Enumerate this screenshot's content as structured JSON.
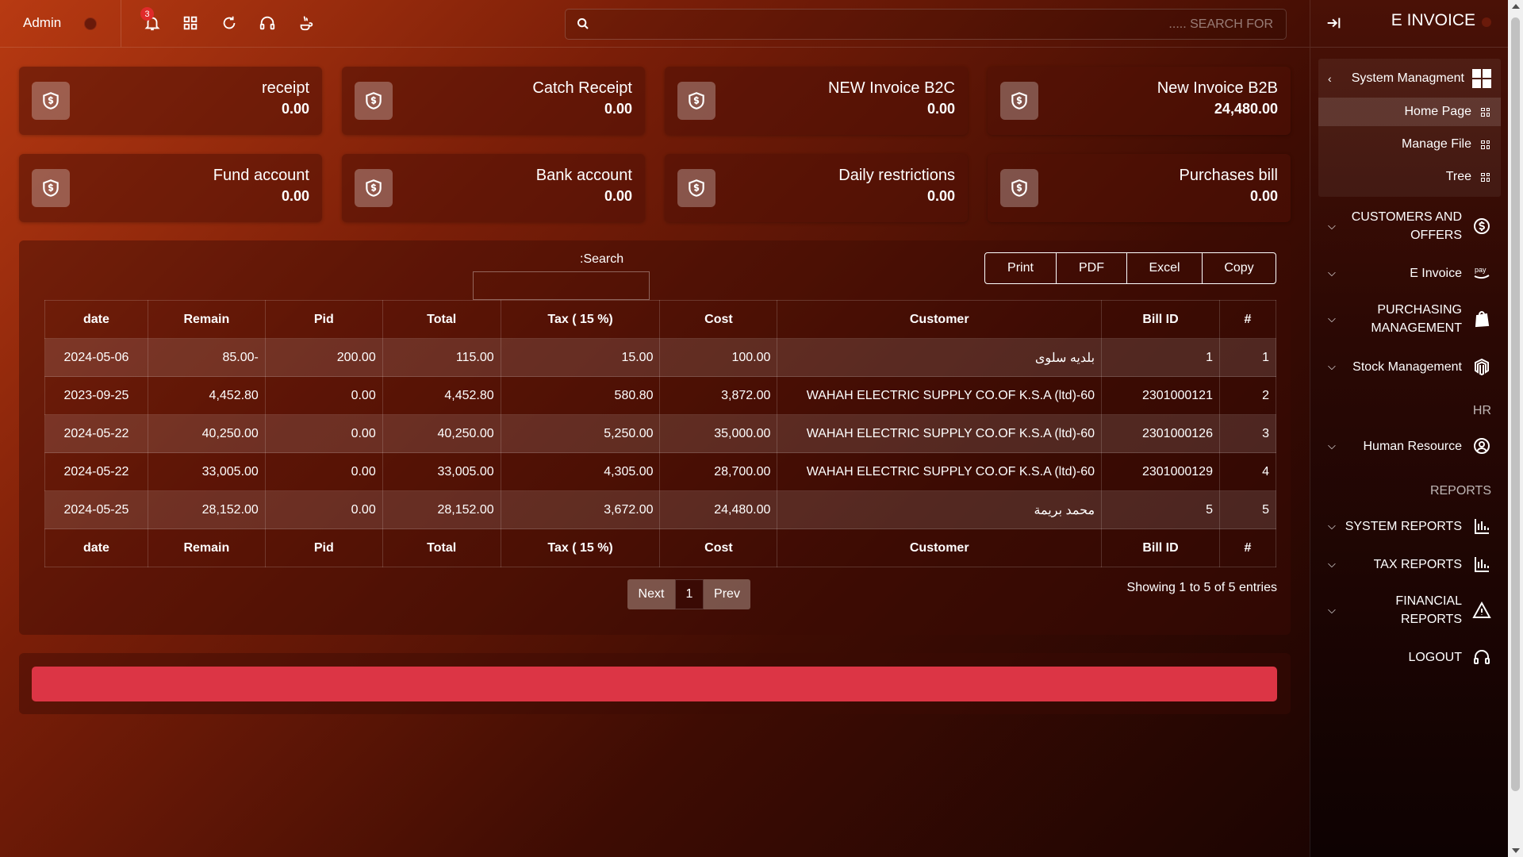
{
  "topbar": {
    "user": "Admin",
    "notification_count": "3",
    "search_placeholder": "..... SEARCH FOR"
  },
  "sidebar": {
    "title": "E INVOICE",
    "system_management": {
      "label": "System Managment",
      "items": [
        {
          "label": "Home Page",
          "active": true
        },
        {
          "label": "Manage File",
          "active": false
        },
        {
          "label": "Tree",
          "active": false
        }
      ]
    },
    "menu": [
      {
        "label": "CUSTOMERS AND OFFERS",
        "icon": "dollar-circle-icon"
      },
      {
        "label": "E Invoice",
        "icon": "pay-icon"
      },
      {
        "label": "PURCHASING MANAGEMENT",
        "icon": "shopify-bag-icon"
      },
      {
        "label": "Stock Management",
        "icon": "magento-icon"
      }
    ],
    "section_hr": "HR",
    "human_resource": "Human Resource",
    "section_reports": "REPORTS",
    "reports": [
      {
        "label": "SYSTEM REPORTS",
        "icon": "bar-chart-icon"
      },
      {
        "label": "TAX REPORTS",
        "icon": "bar-chart-icon"
      },
      {
        "label": "FINANCIAL REPORTS",
        "icon": "warning-icon"
      }
    ],
    "logout": "LOGOUT"
  },
  "cards": [
    {
      "title": "receipt",
      "value": "0.00"
    },
    {
      "title": "Catch Receipt",
      "value": "0.00"
    },
    {
      "title": "NEW Invoice B2C",
      "value": "0.00"
    },
    {
      "title": "New Invoice B2B",
      "value": "24,480.00"
    },
    {
      "title": "Fund account",
      "value": "0.00"
    },
    {
      "title": "Bank account",
      "value": "0.00"
    },
    {
      "title": "Daily restrictions",
      "value": "0.00"
    },
    {
      "title": "Purchases bill",
      "value": "0.00"
    }
  ],
  "table": {
    "search_label": ":Search",
    "buttons": [
      "Print",
      "PDF",
      "Excel",
      "Copy"
    ],
    "headers": [
      "date",
      "Remain",
      "Pid",
      "Total",
      "Tax ( 15 %)",
      "Cost",
      "Customer",
      "Bill ID",
      "#"
    ],
    "rows": [
      [
        "2024-05-06",
        "85.00-",
        "200.00",
        "115.00",
        "15.00",
        "100.00",
        "بلديه سلوى",
        "1",
        "1"
      ],
      [
        "2023-09-25",
        "4,452.80",
        "0.00",
        "4,452.80",
        "580.80",
        "3,872.00",
        "WAHAH ELECTRIC SUPPLY CO.OF K.S.A (ltd)-60",
        "2301000121",
        "2"
      ],
      [
        "2024-05-22",
        "40,250.00",
        "0.00",
        "40,250.00",
        "5,250.00",
        "35,000.00",
        "WAHAH ELECTRIC SUPPLY CO.OF K.S.A (ltd)-60",
        "2301000126",
        "3"
      ],
      [
        "2024-05-22",
        "33,005.00",
        "0.00",
        "33,005.00",
        "4,305.00",
        "28,700.00",
        "WAHAH ELECTRIC SUPPLY CO.OF K.S.A (ltd)-60",
        "2301000129",
        "4"
      ],
      [
        "2024-05-25",
        "28,152.00",
        "0.00",
        "28,152.00",
        "3,672.00",
        "24,480.00",
        "محمد بريمة",
        "5",
        "5"
      ]
    ],
    "pagination": {
      "next": "Next",
      "page": "1",
      "prev": "Prev"
    },
    "entries_info": "Showing 1 to 5 of 5 entries"
  },
  "colors": {
    "alert_bar": "#dc3545",
    "notification_badge": "#e02a2a"
  }
}
